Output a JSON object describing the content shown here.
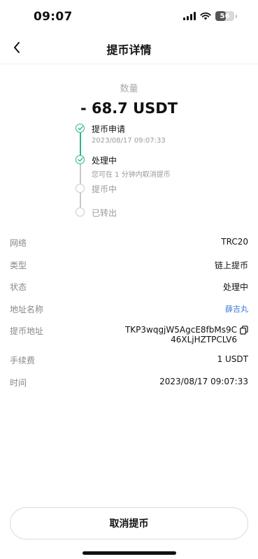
{
  "status_bar": {
    "time": "09:07",
    "battery": "56",
    "battery_level": 0.56
  },
  "nav": {
    "title": "提币详情"
  },
  "summary": {
    "amount_label": "数量",
    "amount": "- 68.7 USDT"
  },
  "timeline": [
    {
      "title": "提币申请",
      "subtitle": "2023/08/17 09:07:33",
      "state": "done"
    },
    {
      "title": "处理中",
      "subtitle": "您可在 1 分钟内取消提币",
      "state": "done"
    },
    {
      "title": "提币中",
      "subtitle": "",
      "state": "pending"
    },
    {
      "title": "已转出",
      "subtitle": "",
      "state": "pending"
    }
  ],
  "details": {
    "network": {
      "label": "网络",
      "value": "TRC20"
    },
    "type": {
      "label": "类型",
      "value": "链上提币"
    },
    "status": {
      "label": "状态",
      "value": "处理中"
    },
    "address_name": {
      "label": "地址名称",
      "value": "薛吉丸"
    },
    "address": {
      "label": "提币地址",
      "line1": "TKP3wqgjW5AgcE8fbMs9C",
      "line2": "46XLjHZTPCLV6"
    },
    "fee": {
      "label": "手续费",
      "value": "1 USDT"
    },
    "time": {
      "label": "时间",
      "value": "2023/08/17 09:07:33"
    }
  },
  "actions": {
    "cancel_label": "取消提币"
  },
  "colors": {
    "accent_green": "#2bb585",
    "link_blue": "#3a7bd5",
    "pending_gray": "#c8c8c8"
  }
}
